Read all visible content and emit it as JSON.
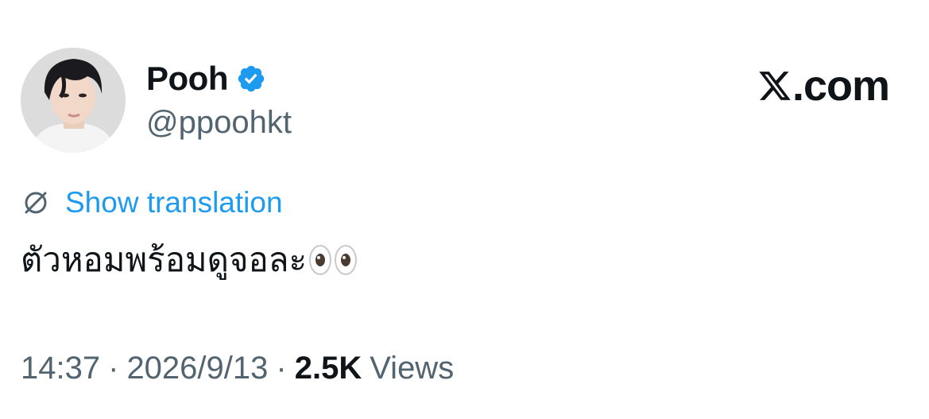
{
  "user": {
    "display_name": "Pooh",
    "handle": "@ppoohkt",
    "verified": true
  },
  "brand": {
    "text": ".com",
    "logo_icon": "x-logo-icon"
  },
  "translation": {
    "label": "Show translation",
    "icon": "globe-icon"
  },
  "tweet": {
    "text": "ตัวหอมพร้อมดูจอละ",
    "emoji": "👀"
  },
  "meta": {
    "time": "14:37",
    "separator": "·",
    "date": "2026/9/13",
    "views_count": "2.5K",
    "views_label": "Views"
  },
  "colors": {
    "accent": "#1d9bf0",
    "text": "#0f1419",
    "muted": "#536471"
  }
}
